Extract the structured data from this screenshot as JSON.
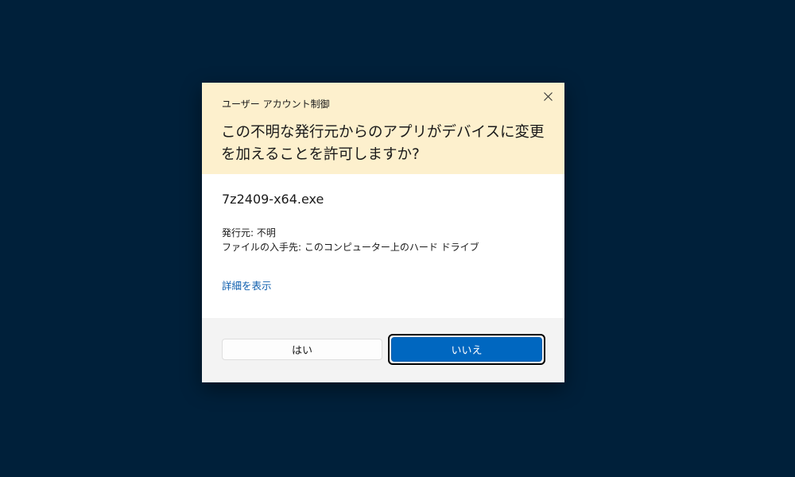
{
  "dialog": {
    "caption": "ユーザー アカウント制御",
    "question": "この不明な発行元からのアプリがデバイスに変更を加えることを許可しますか?",
    "filename": "7z2409-x64.exe",
    "publisher_line": "発行元: 不明",
    "origin_line": "ファイルの入手先: このコンピューター上のハード ドライブ",
    "details_link": "詳細を表示",
    "buttons": {
      "yes_label": "はい",
      "no_label": "いいえ"
    },
    "icons": {
      "close": "close-icon"
    },
    "colors": {
      "background": "#00203a",
      "header": "#fdf0cd",
      "footer": "#f3f3f3",
      "primary_button": "#0067c0",
      "link": "#0b5cad"
    }
  }
}
